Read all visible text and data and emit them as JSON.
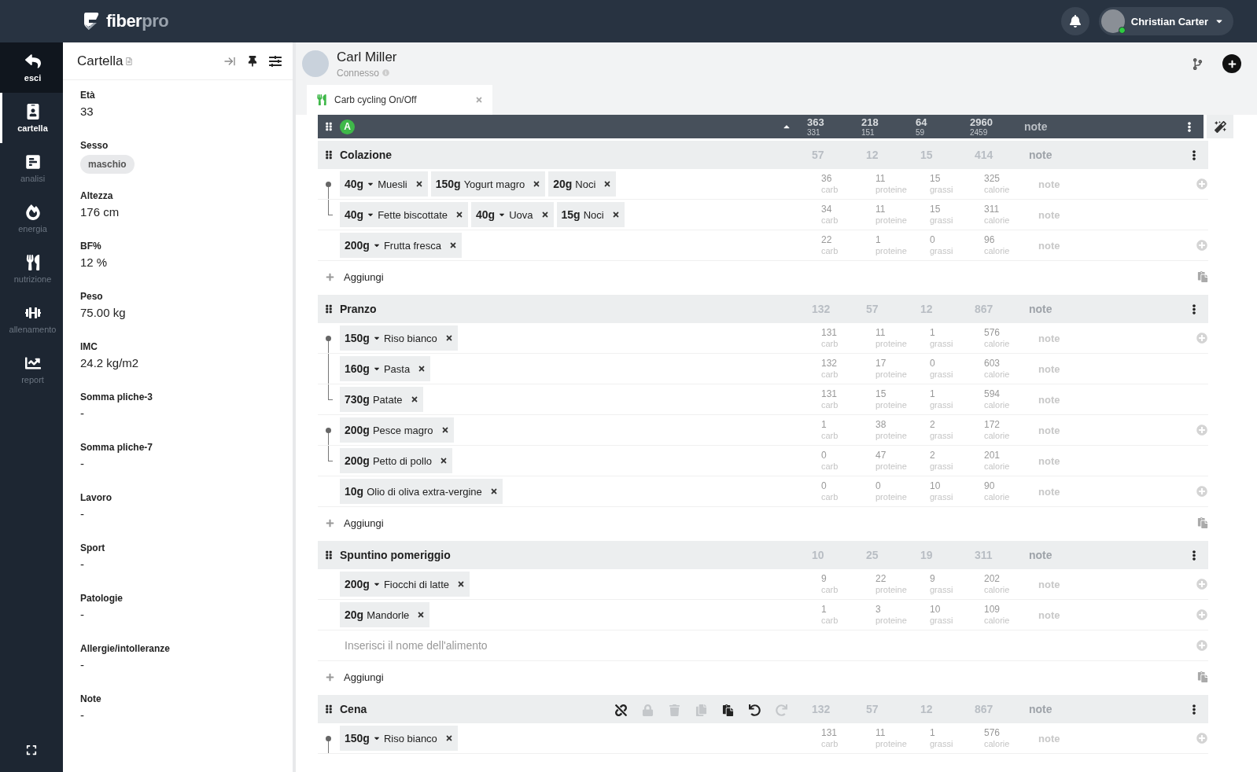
{
  "brand": {
    "name_main": "fiber",
    "name_accent": "pro"
  },
  "user": {
    "name": "Christian Carter"
  },
  "nav": [
    {
      "kind": "back",
      "label": "esci",
      "selected": false
    },
    {
      "kind": "card",
      "label": "cartella",
      "selected": true
    },
    {
      "kind": "analysis",
      "label": "analisi",
      "selected": false
    },
    {
      "kind": "energy",
      "label": "energia",
      "selected": false
    },
    {
      "kind": "nutrition",
      "label": "nutrizione",
      "selected": false
    },
    {
      "kind": "training",
      "label": "allenamento",
      "selected": false
    },
    {
      "kind": "report",
      "label": "report",
      "selected": false
    }
  ],
  "panel": {
    "title": "Cartella",
    "fields": [
      {
        "label": "Età",
        "value": "33",
        "kind": "text"
      },
      {
        "label": "Sesso",
        "value": "maschio",
        "kind": "tag"
      },
      {
        "label": "Altezza",
        "value": "176 cm",
        "kind": "text"
      },
      {
        "label": "BF%",
        "value": "12 %",
        "kind": "text"
      },
      {
        "label": "Peso",
        "value": "75.00 kg",
        "kind": "text"
      },
      {
        "label": "IMC",
        "value": "24.2 kg/m2",
        "kind": "text"
      },
      {
        "label": "Somma pliche-3",
        "value": "-",
        "kind": "text"
      },
      {
        "label": "Somma pliche-7",
        "value": "-",
        "kind": "text"
      },
      {
        "label": "Lavoro",
        "value": "-",
        "kind": "text"
      },
      {
        "label": "Sport",
        "value": "-",
        "kind": "text"
      },
      {
        "label": "Patologie",
        "value": "-",
        "kind": "text"
      },
      {
        "label": "Allergie/intolleranze",
        "value": "-",
        "kind": "text"
      },
      {
        "label": "Note",
        "value": "-",
        "kind": "text"
      }
    ]
  },
  "patient": {
    "name": "Carl Miller",
    "status": "Connesso"
  },
  "tabs": [
    {
      "label": "Carb cycling On/Off",
      "selected": true
    }
  ],
  "summary": {
    "badge": "A",
    "totals": [
      {
        "main": "363",
        "sub": "331"
      },
      {
        "main": "218",
        "sub": "151"
      },
      {
        "main": "64",
        "sub": "59"
      },
      {
        "main": "2960",
        "sub": "2459"
      }
    ],
    "note": "note"
  },
  "meals": [
    {
      "name": "Colazione",
      "totals": [
        "57",
        "12",
        "15",
        "414"
      ],
      "note": "note",
      "add_label": "Aggiungi",
      "rows": [
        {
          "kind": "food",
          "linked_up": false,
          "linked_down": true,
          "add_icon": true,
          "foods": [
            {
              "amount": "40g",
              "name": "Muesli",
              "dropdown": true
            },
            {
              "amount": "150g",
              "name": "Yogurt magro",
              "dropdown": false
            },
            {
              "amount": "20g",
              "name": "Noci",
              "dropdown": false
            }
          ],
          "macros": [
            {
              "value": "36",
              "label": "carb"
            },
            {
              "value": "11",
              "label": "proteine"
            },
            {
              "value": "15",
              "label": "grassi"
            },
            {
              "value": "325",
              "label": "calorie"
            }
          ],
          "note": "note"
        },
        {
          "kind": "food",
          "linked_up": true,
          "linked_down": false,
          "add_icon": false,
          "foods": [
            {
              "amount": "40g",
              "name": "Fette biscottate",
              "dropdown": true
            },
            {
              "amount": "40g",
              "name": "Uova",
              "dropdown": true
            },
            {
              "amount": "15g",
              "name": "Noci",
              "dropdown": false
            }
          ],
          "macros": [
            {
              "value": "34",
              "label": "carb"
            },
            {
              "value": "11",
              "label": "proteine"
            },
            {
              "value": "15",
              "label": "grassi"
            },
            {
              "value": "311",
              "label": "calorie"
            }
          ],
          "note": "note"
        },
        {
          "kind": "food",
          "linked_up": false,
          "linked_down": false,
          "add_icon": true,
          "foods": [
            {
              "amount": "200g",
              "name": "Frutta fresca",
              "dropdown": true
            }
          ],
          "macros": [
            {
              "value": "22",
              "label": "carb"
            },
            {
              "value": "1",
              "label": "proteine"
            },
            {
              "value": "0",
              "label": "grassi"
            },
            {
              "value": "96",
              "label": "calorie"
            }
          ],
          "note": "note"
        }
      ]
    },
    {
      "name": "Pranzo",
      "totals": [
        "132",
        "57",
        "12",
        "867"
      ],
      "note": "note",
      "add_label": "Aggiungi",
      "rows": [
        {
          "kind": "food",
          "linked_up": false,
          "linked_down": true,
          "add_icon": true,
          "foods": [
            {
              "amount": "150g",
              "name": "Riso bianco",
              "dropdown": true
            }
          ],
          "macros": [
            {
              "value": "131",
              "label": "carb"
            },
            {
              "value": "11",
              "label": "proteine"
            },
            {
              "value": "1",
              "label": "grassi"
            },
            {
              "value": "576",
              "label": "calorie"
            }
          ],
          "note": "note"
        },
        {
          "kind": "food",
          "linked_up": true,
          "linked_down": true,
          "add_icon": false,
          "foods": [
            {
              "amount": "160g",
              "name": "Pasta",
              "dropdown": true
            }
          ],
          "macros": [
            {
              "value": "132",
              "label": "carb"
            },
            {
              "value": "17",
              "label": "proteine"
            },
            {
              "value": "0",
              "label": "grassi"
            },
            {
              "value": "603",
              "label": "calorie"
            }
          ],
          "note": "note"
        },
        {
          "kind": "food",
          "linked_up": true,
          "linked_down": false,
          "add_icon": false,
          "foods": [
            {
              "amount": "730g",
              "name": "Patate",
              "dropdown": false
            }
          ],
          "macros": [
            {
              "value": "131",
              "label": "carb"
            },
            {
              "value": "15",
              "label": "proteine"
            },
            {
              "value": "1",
              "label": "grassi"
            },
            {
              "value": "594",
              "label": "calorie"
            }
          ],
          "note": "note"
        },
        {
          "kind": "food",
          "linked_up": false,
          "linked_down": true,
          "add_icon": true,
          "foods": [
            {
              "amount": "200g",
              "name": "Pesce magro",
              "dropdown": false
            }
          ],
          "macros": [
            {
              "value": "1",
              "label": "carb"
            },
            {
              "value": "38",
              "label": "proteine"
            },
            {
              "value": "2",
              "label": "grassi"
            },
            {
              "value": "172",
              "label": "calorie"
            }
          ],
          "note": "note"
        },
        {
          "kind": "food",
          "linked_up": true,
          "linked_down": false,
          "add_icon": false,
          "foods": [
            {
              "amount": "200g",
              "name": "Petto di pollo",
              "dropdown": false
            }
          ],
          "macros": [
            {
              "value": "0",
              "label": "carb"
            },
            {
              "value": "47",
              "label": "proteine"
            },
            {
              "value": "2",
              "label": "grassi"
            },
            {
              "value": "201",
              "label": "calorie"
            }
          ],
          "note": "note"
        },
        {
          "kind": "food",
          "linked_up": false,
          "linked_down": false,
          "add_icon": true,
          "foods": [
            {
              "amount": "10g",
              "name": "Olio di oliva extra-vergine",
              "dropdown": false
            }
          ],
          "macros": [
            {
              "value": "0",
              "label": "carb"
            },
            {
              "value": "0",
              "label": "proteine"
            },
            {
              "value": "10",
              "label": "grassi"
            },
            {
              "value": "90",
              "label": "calorie"
            }
          ],
          "note": "note"
        }
      ]
    },
    {
      "name": "Spuntino pomeriggio",
      "totals": [
        "10",
        "25",
        "19",
        "311"
      ],
      "note": "note",
      "add_label": "Aggiungi",
      "rows": [
        {
          "kind": "food",
          "linked_up": false,
          "linked_down": false,
          "add_icon": true,
          "foods": [
            {
              "amount": "200g",
              "name": "Fiocchi di latte",
              "dropdown": true
            }
          ],
          "macros": [
            {
              "value": "9",
              "label": "carb"
            },
            {
              "value": "22",
              "label": "proteine"
            },
            {
              "value": "9",
              "label": "grassi"
            },
            {
              "value": "202",
              "label": "calorie"
            }
          ],
          "note": "note"
        },
        {
          "kind": "food",
          "linked_up": false,
          "linked_down": false,
          "add_icon": true,
          "foods": [
            {
              "amount": "20g",
              "name": "Mandorle",
              "dropdown": false
            }
          ],
          "macros": [
            {
              "value": "1",
              "label": "carb"
            },
            {
              "value": "3",
              "label": "proteine"
            },
            {
              "value": "10",
              "label": "grassi"
            },
            {
              "value": "109",
              "label": "calorie"
            }
          ],
          "note": "note"
        },
        {
          "kind": "input",
          "linked_up": false,
          "linked_down": false,
          "add_icon": true,
          "placeholder": "Inserisci il nome dell'alimento"
        }
      ]
    },
    {
      "name": "Cena",
      "totals": [
        "132",
        "57",
        "12",
        "867"
      ],
      "note": "note",
      "rows": [
        {
          "kind": "food",
          "linked_up": false,
          "linked_down": true,
          "add_icon": true,
          "foods": [
            {
              "amount": "150g",
              "name": "Riso bianco",
              "dropdown": true
            }
          ],
          "macros": [
            {
              "value": "131",
              "label": "carb"
            },
            {
              "value": "11",
              "label": "proteine"
            },
            {
              "value": "1",
              "label": "grassi"
            },
            {
              "value": "576",
              "label": "calorie"
            }
          ],
          "note": "note"
        }
      ]
    }
  ],
  "toolbar": [
    {
      "kind": "unlink",
      "disabled": false
    },
    {
      "kind": "lock",
      "disabled": true
    },
    {
      "kind": "trash",
      "disabled": true
    },
    {
      "kind": "copy",
      "disabled": true
    },
    {
      "kind": "paste",
      "disabled": false
    },
    {
      "kind": "undo",
      "disabled": false
    },
    {
      "kind": "redo",
      "disabled": true
    }
  ]
}
